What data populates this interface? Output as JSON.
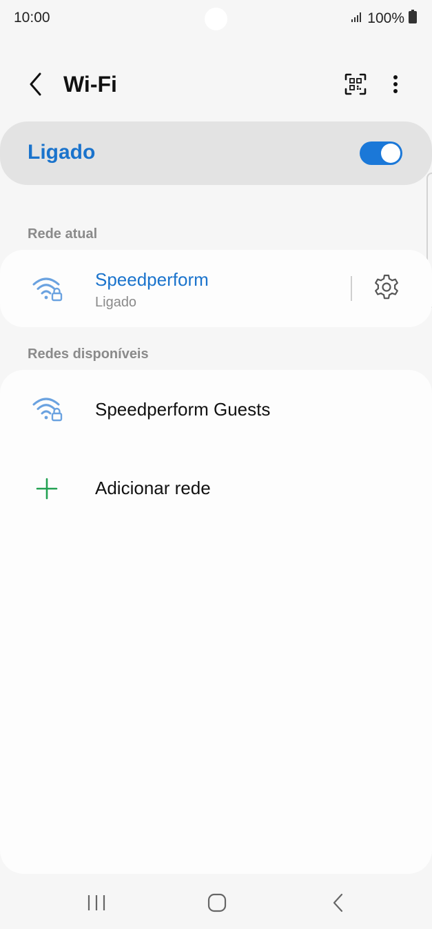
{
  "status_bar": {
    "time": "10:00",
    "battery": "100%"
  },
  "header": {
    "title": "Wi-Fi"
  },
  "master_toggle": {
    "label": "Ligado",
    "on": true,
    "accent_color": "#1a73cc"
  },
  "current_network": {
    "section_title": "Rede atual",
    "name": "Speedperform",
    "status": "Ligado"
  },
  "available_networks": {
    "section_title": "Redes disponíveis",
    "networks": [
      {
        "name": "Speedperform Guests",
        "icon": "wifi-lock-icon"
      }
    ],
    "add_network_label": "Adicionar rede"
  },
  "icons": {
    "back": "chevron-left-icon",
    "qr": "qr-scan-icon",
    "more": "more-vertical-icon",
    "settings": "gear-icon",
    "add": "plus-icon"
  }
}
